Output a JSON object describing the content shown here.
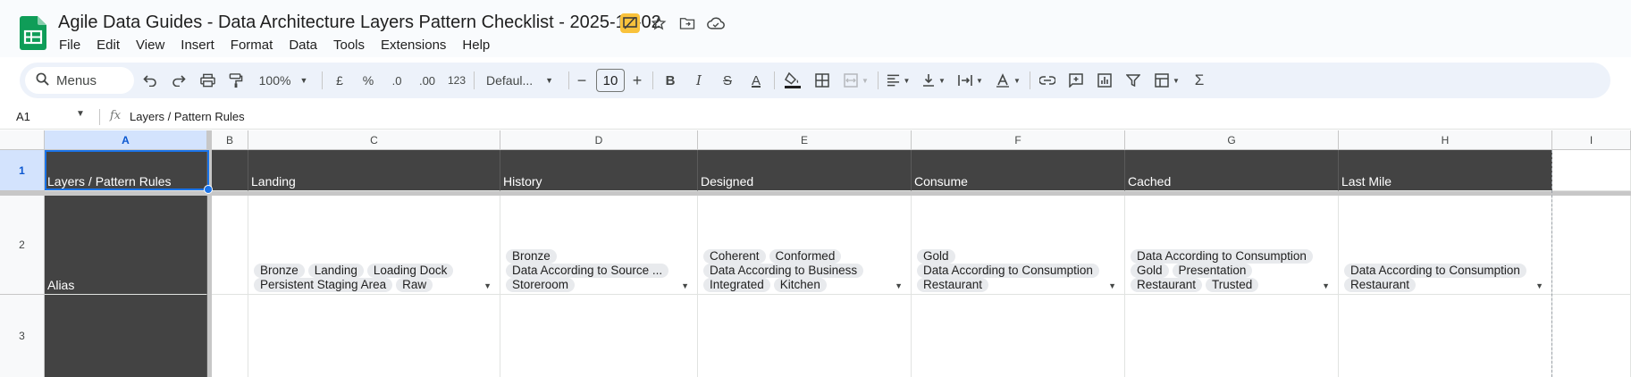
{
  "app": {
    "icon": "sheets-logo-icon"
  },
  "doc": {
    "title": "Agile Data Guides - Data Architecture Layers Pattern Checklist - 2025-10-02"
  },
  "menu": [
    "File",
    "Edit",
    "View",
    "Insert",
    "Format",
    "Data",
    "Tools",
    "Extensions",
    "Help"
  ],
  "toolbar": {
    "search": "Menus",
    "zoom": "100%",
    "currency": "£",
    "percent": "%",
    "dec_decrease": ".0",
    "dec_increase": ".00",
    "number_format": "123",
    "font": "Defaul...",
    "font_size": "10",
    "minus": "−",
    "plus": "+"
  },
  "formula_bar": {
    "cell_ref": "A1",
    "fx": "fx",
    "content": "Layers / Pattern Rules"
  },
  "columns": [
    "A",
    "B",
    "C",
    "D",
    "E",
    "F",
    "G",
    "H",
    "I"
  ],
  "rows": [
    "1",
    "2",
    "3"
  ],
  "header_row": {
    "a": "Layers / Pattern Rules",
    "c": "Landing",
    "d": "History",
    "e": "Designed",
    "f": "Consume",
    "g": "Cached",
    "h": "Last Mile"
  },
  "alias_row": {
    "a": "Alias",
    "c": [
      [
        "Bronze",
        "Landing",
        "Loading Dock"
      ],
      [
        "Persistent Staging Area",
        "Raw"
      ]
    ],
    "d": [
      [
        "Bronze"
      ],
      [
        "Data According to Source ..."
      ],
      [
        "Storeroom"
      ]
    ],
    "e": [
      [
        "Coherent",
        "Conformed"
      ],
      [
        "Data According to Business"
      ],
      [
        "Integrated",
        "Kitchen"
      ]
    ],
    "f": [
      [
        "Gold"
      ],
      [
        "Data According to Consumption"
      ],
      [
        "Restaurant"
      ]
    ],
    "g": [
      [
        "Data According to Consumption"
      ],
      [
        "Gold",
        "Presentation"
      ],
      [
        "Restaurant",
        "Trusted"
      ]
    ],
    "h": [
      [
        "Data According to Consumption"
      ],
      [
        "Restaurant"
      ]
    ]
  },
  "colors": {
    "accent": "#1a73e8",
    "header_fill": "#434343",
    "chip_bg": "#e8eaed",
    "toolbar_bg": "#edf2fa"
  }
}
